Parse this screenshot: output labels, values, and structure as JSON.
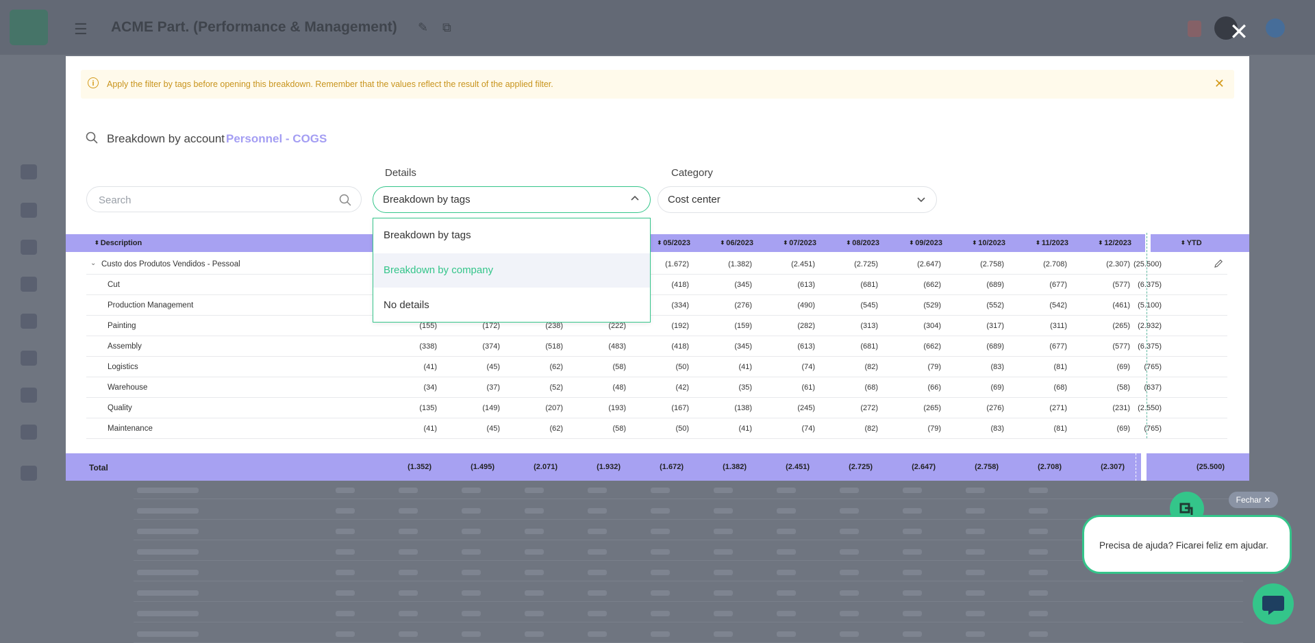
{
  "background": {
    "app_title": "ACME Part. (Performance & Management)"
  },
  "alert": {
    "icon": "info-icon",
    "text": "Apply the filter by tags before opening this breakdown. Remember that the values reflect the result of the applied filter."
  },
  "breakdown": {
    "prefix": "Breakdown by account",
    "account": "Personnel - COGS"
  },
  "filters": {
    "details_label": "Details",
    "category_label": "Category",
    "search_placeholder": "Search",
    "details_value": "Breakdown by tags",
    "category_value": "Cost center"
  },
  "dropdown": {
    "options": [
      "Breakdown by tags",
      "Breakdown by company",
      "No details"
    ],
    "highlighted": "Breakdown by company"
  },
  "table": {
    "headers": {
      "description": "Description",
      "months": [
        "05/2023",
        "06/2023",
        "07/2023",
        "08/2023",
        "09/2023",
        "10/2023",
        "11/2023",
        "12/2023"
      ],
      "ytd": "YTD"
    },
    "rows": [
      {
        "desc": "Custo dos Produtos Vendidos - Pessoal",
        "values": [
          "",
          "",
          "",
          "",
          "(1.672)",
          "(1.382)",
          "(2.451)",
          "(2.725)",
          "(2.647)",
          "(2.758)",
          "(2.708)",
          "(2.307)"
        ],
        "ytd": "(25.500)"
      },
      {
        "desc": "Cut",
        "values": [
          "",
          "",
          "",
          "",
          "(418)",
          "(345)",
          "(613)",
          "(681)",
          "(662)",
          "(689)",
          "(677)",
          "(577)"
        ],
        "ytd": "(6.375)"
      },
      {
        "desc": "Production Management",
        "values": [
          "",
          "",
          "",
          "",
          "(334)",
          "(276)",
          "(490)",
          "(545)",
          "(529)",
          "(552)",
          "(542)",
          "(461)"
        ],
        "ytd": "(5.100)"
      },
      {
        "desc": "Painting",
        "values": [
          "(155)",
          "(172)",
          "(238)",
          "(222)",
          "(192)",
          "(159)",
          "(282)",
          "(313)",
          "(304)",
          "(317)",
          "(311)",
          "(265)"
        ],
        "ytd": "(2.932)"
      },
      {
        "desc": "Assembly",
        "values": [
          "(338)",
          "(374)",
          "(518)",
          "(483)",
          "(418)",
          "(345)",
          "(613)",
          "(681)",
          "(662)",
          "(689)",
          "(677)",
          "(577)"
        ],
        "ytd": "(6.375)"
      },
      {
        "desc": "Logistics",
        "values": [
          "(41)",
          "(45)",
          "(62)",
          "(58)",
          "(50)",
          "(41)",
          "(74)",
          "(82)",
          "(79)",
          "(83)",
          "(81)",
          "(69)"
        ],
        "ytd": "(765)"
      },
      {
        "desc": "Warehouse",
        "values": [
          "(34)",
          "(37)",
          "(52)",
          "(48)",
          "(42)",
          "(35)",
          "(61)",
          "(68)",
          "(66)",
          "(69)",
          "(68)",
          "(58)"
        ],
        "ytd": "(637)"
      },
      {
        "desc": "Quality",
        "values": [
          "(135)",
          "(149)",
          "(207)",
          "(193)",
          "(167)",
          "(138)",
          "(245)",
          "(272)",
          "(265)",
          "(276)",
          "(271)",
          "(231)"
        ],
        "ytd": "(2.550)"
      },
      {
        "desc": "Maintenance",
        "values": [
          "(41)",
          "(45)",
          "(62)",
          "(58)",
          "(50)",
          "(41)",
          "(74)",
          "(82)",
          "(79)",
          "(83)",
          "(81)",
          "(69)"
        ],
        "ytd": "(765)"
      }
    ],
    "total": {
      "label": "Total",
      "values": [
        "(1.352)",
        "(1.495)",
        "(2.071)",
        "(1.932)",
        "(1.672)",
        "(1.382)",
        "(2.451)",
        "(2.725)",
        "(2.647)",
        "(2.758)",
        "(2.708)",
        "(2.307)"
      ],
      "ytd": "(25.500)"
    }
  },
  "chat": {
    "close_label": "Fechar ✕",
    "message": "Precisa de ajuda? Ficarei feliz em ajudar."
  },
  "colors": {
    "accent_green": "#34c58a",
    "header_purple": "#a7a1f2",
    "account_purple": "#a49ef3",
    "alert_text": "#c8941d"
  }
}
